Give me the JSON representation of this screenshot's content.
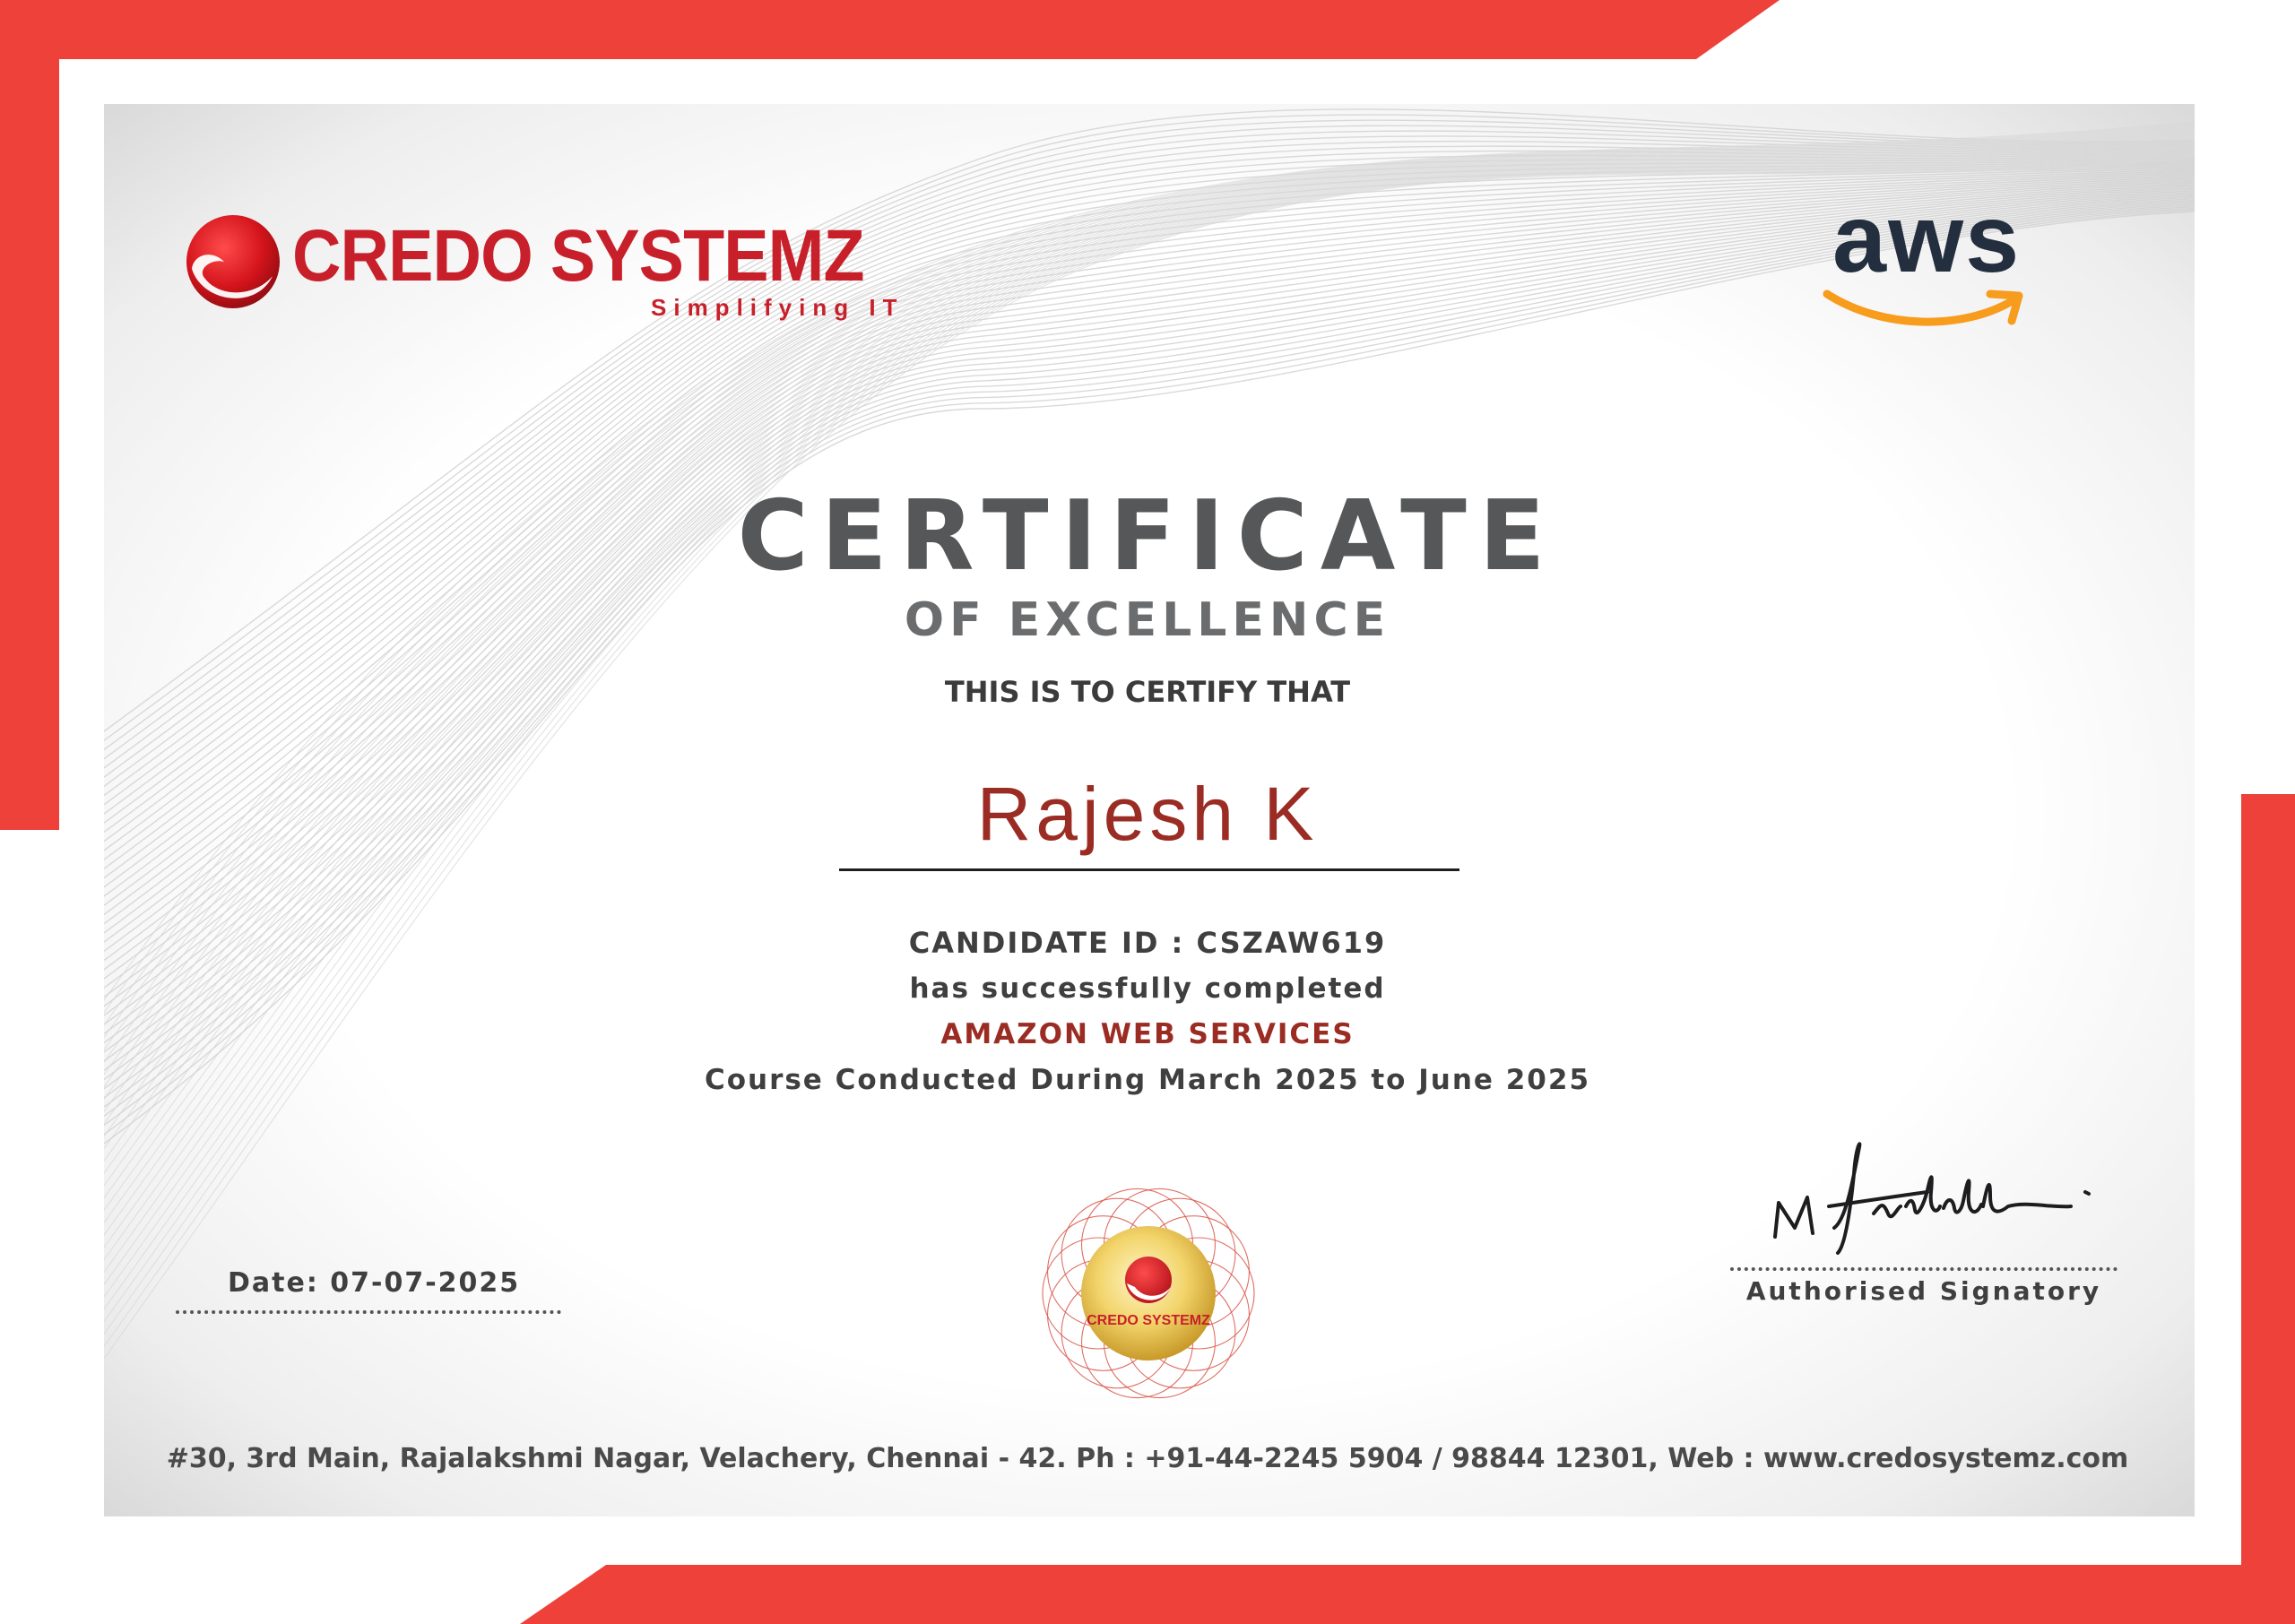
{
  "colors": {
    "frame_red": "#ee413a",
    "brand_red": "#c8202a",
    "name_red": "#9b2c23",
    "aws_navy": "#232f3e",
    "aws_orange": "#f79c1c",
    "title_gray": "#555758"
  },
  "branding": {
    "company_name": "CREDO SYSTEMZ",
    "company_tagline": "Simplifying IT",
    "partner_logo_text": "aws",
    "seal_text": "CREDO SYSTEMZ"
  },
  "certificate": {
    "title": "CERTIFICATE",
    "subtitle": "OF EXCELLENCE",
    "certify_line": "THIS IS TO CERTIFY THAT",
    "candidate_name": "Rajesh K",
    "candidate_id_line": "CANDIDATE ID : CSZAW619",
    "completion_line": "has successfully completed",
    "course_name": "AMAZON WEB SERVICES",
    "period_line": "Course Conducted During March 2025 to June 2025"
  },
  "footer": {
    "date_line": "Date: 07-07-2025",
    "signatory_label": "Authorised Signatory",
    "address_line": "#30, 3rd Main, Rajalakshmi Nagar, Velachery, Chennai - 42. Ph : +91-44-2245 5904 / 98844 12301, Web : www.credosystemz.com"
  }
}
